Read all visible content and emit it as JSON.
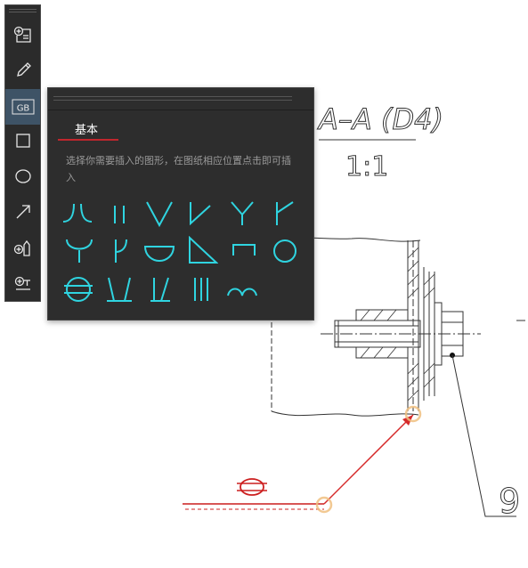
{
  "toolbar": {
    "items": [
      {
        "name": "insert-text-tool",
        "icon": "insert-text-icon"
      },
      {
        "name": "pencil-tool",
        "icon": "pencil-icon"
      },
      {
        "name": "gb-symbols-tool",
        "icon": "gb-icon",
        "label": "GB",
        "active": true
      },
      {
        "name": "rectangle-tool",
        "icon": "rectangle-icon"
      },
      {
        "name": "ellipse-tool",
        "icon": "ellipse-icon"
      },
      {
        "name": "arrow-tool",
        "icon": "arrow-icon"
      },
      {
        "name": "insert-attachment-tool",
        "icon": "insert-attachment-icon"
      },
      {
        "name": "insert-text-box-tool",
        "icon": "insert-text-box-icon"
      }
    ]
  },
  "panel": {
    "tab_label": "基本",
    "hint": "选择你需要插入的图形，在图纸相应位置点击即可插入",
    "symbol_color": "#2fd4e0",
    "symbols": [
      "weld-flare-bevel",
      "weld-square-groove",
      "weld-v-groove",
      "weld-bevel-groove",
      "weld-y-groove",
      "weld-j-bevel",
      "weld-u-groove",
      "weld-j-groove",
      "weld-backing-run",
      "weld-fillet",
      "weld-plug-slot",
      "weld-spot",
      "weld-seam",
      "weld-steep-v",
      "weld-steep-bevel",
      "weld-surfacing",
      "weld-edge-flange"
    ]
  },
  "drawing": {
    "section_label": "A–A (D4)",
    "scale_label": "1:1",
    "balloon_number": "9",
    "leader_color": "#e02020",
    "marker_color": "#f0c080"
  }
}
